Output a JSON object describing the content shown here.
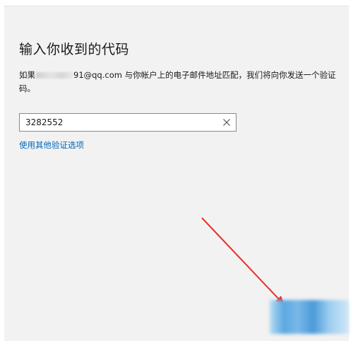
{
  "dialog": {
    "title": "输入你收到的代码",
    "desc_prefix": "如果",
    "desc_email_visible": "91@qq.com",
    "desc_suffix": " 与你帐户上的电子邮件地址匹配，我们将向你发送一个验证",
    "desc_line2": "码。",
    "code_value": "3282552",
    "other_options_link": "使用其他验证选项"
  },
  "colors": {
    "link": "#0067b8",
    "arrow": "#e8302a",
    "button": "#4a9ad8"
  },
  "icons": {
    "clear": "close-icon"
  }
}
